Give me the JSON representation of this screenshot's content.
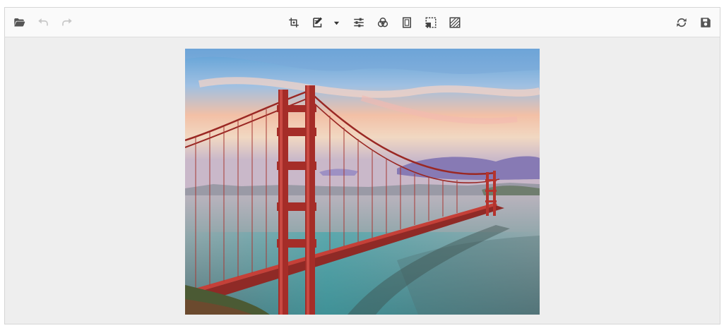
{
  "toolbar": {
    "left": [
      {
        "id": "open",
        "icon": "folder-open-icon",
        "enabled": true
      },
      {
        "id": "undo",
        "icon": "undo-icon",
        "enabled": false
      },
      {
        "id": "redo",
        "icon": "redo-icon",
        "enabled": false
      }
    ],
    "center": [
      {
        "id": "crop",
        "icon": "crop-icon"
      },
      {
        "id": "annotate",
        "icon": "edit-annotate-icon",
        "has_dropdown": true
      },
      {
        "id": "finetune",
        "icon": "sliders-icon"
      },
      {
        "id": "filters",
        "icon": "filter-circles-icon"
      },
      {
        "id": "frame",
        "icon": "frame-icon"
      },
      {
        "id": "redact",
        "icon": "redact-selection-icon"
      },
      {
        "id": "transparency",
        "icon": "hatch-transparency-icon"
      }
    ],
    "right": [
      {
        "id": "reset",
        "icon": "refresh-icon"
      },
      {
        "id": "save",
        "icon": "save-icon"
      }
    ]
  },
  "canvas": {
    "image": "golden-gate-bridge-photo",
    "colors": {
      "sky_top": "#5b9fd6",
      "sky_mid": "#f3c0a6",
      "bridge": "#b6302b",
      "water": "#6f8f94",
      "cloud": "#7b6fb0"
    }
  },
  "colors": {
    "toolbar_bg": "#fafafa",
    "canvas_bg": "#eeeeee",
    "icon": "#555555",
    "icon_disabled": "#9a9a9a"
  }
}
